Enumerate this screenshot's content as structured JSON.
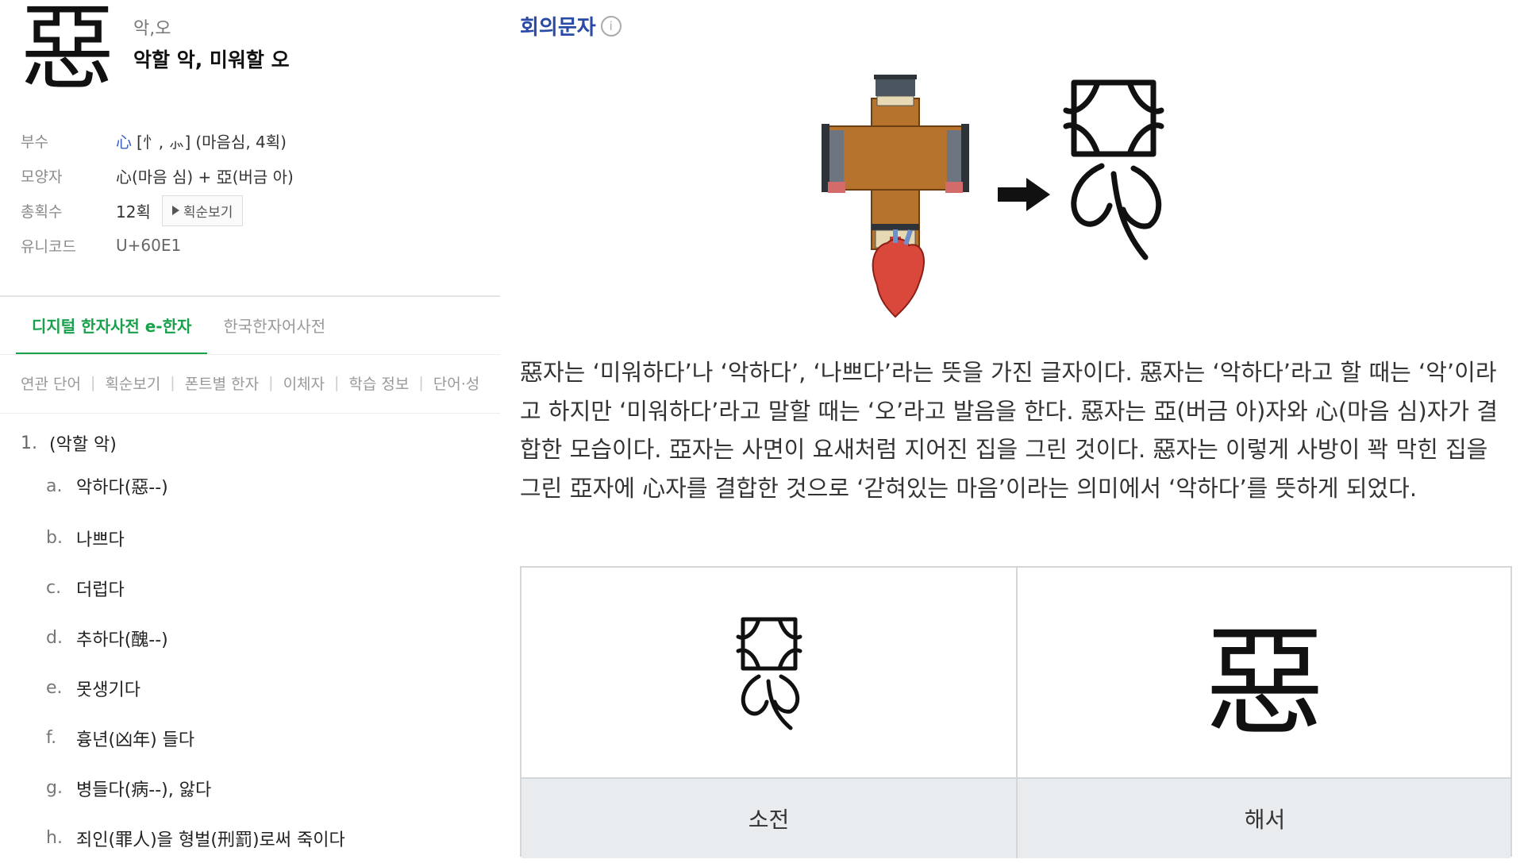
{
  "header": {
    "hanja": "惡",
    "readings": "악,오",
    "meaning": "악할 악, 미워할 오"
  },
  "info": {
    "radical_label": "부수",
    "radical_char": "心",
    "radical_variants": "[忄, ⺗]",
    "radical_note": "(마음심, 4획)",
    "shape_label": "모양자",
    "shape_value": "心(마음 심) + 亞(버금 아)",
    "strokes_label": "총획수",
    "strokes_value": "12획",
    "stroke_button": "획순보기",
    "unicode_label": "유니코드",
    "unicode_value": "U+60E1"
  },
  "tabs": [
    "디지털 한자사전 e-한자",
    "한국한자어사전"
  ],
  "subnav": [
    "연관 단어",
    "획순보기",
    "폰트별 한자",
    "이체자",
    "학습 정보",
    "단어·성"
  ],
  "definitions": {
    "head_num": "1.",
    "head_text": "(악할 악)",
    "items": [
      {
        "letter": "a.",
        "text": "악하다(惡--)"
      },
      {
        "letter": "b.",
        "text": "나쁘다"
      },
      {
        "letter": "c.",
        "text": "더럽다"
      },
      {
        "letter": "d.",
        "text": "추하다(醜--)"
      },
      {
        "letter": "e.",
        "text": "못생기다"
      },
      {
        "letter": "f.",
        "text": "흉년(凶年) 들다"
      },
      {
        "letter": "g.",
        "text": "병들다(病--), 앓다"
      },
      {
        "letter": "h.",
        "text": "죄인(罪人)을 형벌(刑罰)로써 죽이다"
      }
    ]
  },
  "right": {
    "type_title": "회의문자",
    "info_icon": "i",
    "explanation": "惡자는 ‘미워하다’나 ‘악하다’, ‘나쁘다’라는 뜻을 가진 글자이다. 惡자는 ‘악하다’라고 할 때는 ‘악’이라고 하지만 ‘미워하다’라고 말할 때는 ‘오’라고 발음을 한다. 惡자는 亞(버금 아)자와 心(마음 심)자가 결합한 모습이다. 亞자는 사면이 요새처럼 지어진 집을 그린 것이다. 惡자는 이렇게 사방이 꽉 막힌 집을 그린 亞자에 心자를 결합한 것으로 ‘갇혀있는 마음’이라는 의미에서 ‘악하다’를 뜻하게 되었다.",
    "table": {
      "col1_label": "소전",
      "col2_label": "해서",
      "col2_char": "惡"
    }
  },
  "colors": {
    "accent_green": "#19a04b",
    "title_blue": "#2a4aa7",
    "radical_blue": "#3b61c7"
  }
}
